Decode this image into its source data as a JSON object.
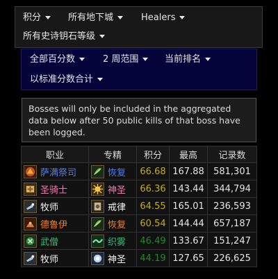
{
  "filters": {
    "score": "积分",
    "dungeons": "所有地下城",
    "role": "Healers",
    "keystone_level": "所有史诗钥石等级"
  },
  "filters2": {
    "percentile": "全部百分数",
    "range": "2 周范围",
    "ranking": "当前排名",
    "aggregate": "以标准分数合计"
  },
  "notice": "Bosses will only be included in the aggregated data below after 50 public kills of that boss have been logged.",
  "table": {
    "headers": [
      "职业",
      "专精",
      "积分",
      "最高",
      "记录数"
    ],
    "rows": [
      {
        "class": "萨满祭司",
        "class_color": "#4c7ff2",
        "class_icon": "shaman-icon",
        "spec": "恢复",
        "spec_color": "#4c7ff2",
        "spec_icon": "restoration-icon",
        "score": "66.68",
        "score_color": "#c8b000",
        "best": "167.88",
        "count": "581,301"
      },
      {
        "class": "圣骑士",
        "class_color": "#f07ab0",
        "class_icon": "paladin-icon",
        "spec": "神圣",
        "spec_color": "#f07ab0",
        "spec_icon": "holy-icon",
        "score": "66.36",
        "score_color": "#c8b000",
        "best": "143.44",
        "count": "344,794"
      },
      {
        "class": "牧师",
        "class_color": "#f2f2f2",
        "class_icon": "priest-icon",
        "spec": "戒律",
        "spec_color": "#f2f2f2",
        "spec_icon": "discipline-icon",
        "score": "64.55",
        "score_color": "#c8b000",
        "best": "165.01",
        "count": "236,593"
      },
      {
        "class": "德鲁伊",
        "class_color": "#f08020",
        "class_icon": "druid-icon",
        "spec": "恢复",
        "spec_color": "#f08020",
        "spec_icon": "restoration-icon",
        "score": "60.54",
        "score_color": "#c8b000",
        "best": "144.44",
        "count": "657,187"
      },
      {
        "class": "武僧",
        "class_color": "#28c07a",
        "class_icon": "monk-icon",
        "spec": "织雾",
        "spec_color": "#28c07a",
        "spec_icon": "mistweaver-icon",
        "score": "46.49",
        "score_color": "#1f8a2a",
        "best": "133.67",
        "count": "151,247"
      },
      {
        "class": "牧师",
        "class_color": "#f2f2f2",
        "class_icon": "priest-icon",
        "spec": "神圣",
        "spec_color": "#f2f2f2",
        "spec_icon": "holy-priest-icon",
        "score": "44.19",
        "score_color": "#1f8a2a",
        "best": "127.65",
        "count": "226,625"
      }
    ]
  }
}
